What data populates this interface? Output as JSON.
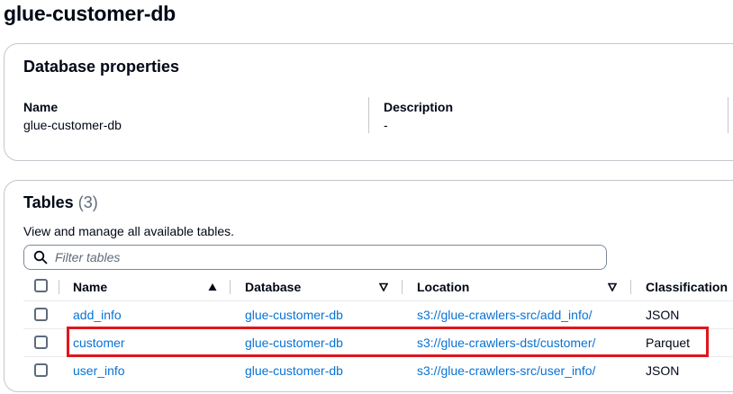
{
  "page_title": "glue-customer-db",
  "properties": {
    "title": "Database properties",
    "name_label": "Name",
    "name_value": "glue-customer-db",
    "description_label": "Description",
    "description_value": "-"
  },
  "tables": {
    "title": "Tables",
    "count": "(3)",
    "description": "View and manage all available tables.",
    "search_placeholder": "Filter tables",
    "columns": {
      "name": "Name",
      "database": "Database",
      "location": "Location",
      "classification": "Classification"
    },
    "rows": [
      {
        "name": "add_info",
        "database": "glue-customer-db",
        "location": "s3://glue-crawlers-src/add_info/",
        "classification": "JSON"
      },
      {
        "name": "customer",
        "database": "glue-customer-db",
        "location": "s3://glue-crawlers-dst/customer/",
        "classification": "Parquet"
      },
      {
        "name": "user_info",
        "database": "glue-customer-db",
        "location": "s3://glue-crawlers-src/user_info/",
        "classification": "JSON"
      }
    ]
  },
  "colors": {
    "link": "#0972d3",
    "highlight": "#e1151d",
    "text": "#000716",
    "border": "#c6c6cd"
  },
  "icons": [
    "search-icon",
    "sort-ascending-icon",
    "sort-descending-icon"
  ]
}
